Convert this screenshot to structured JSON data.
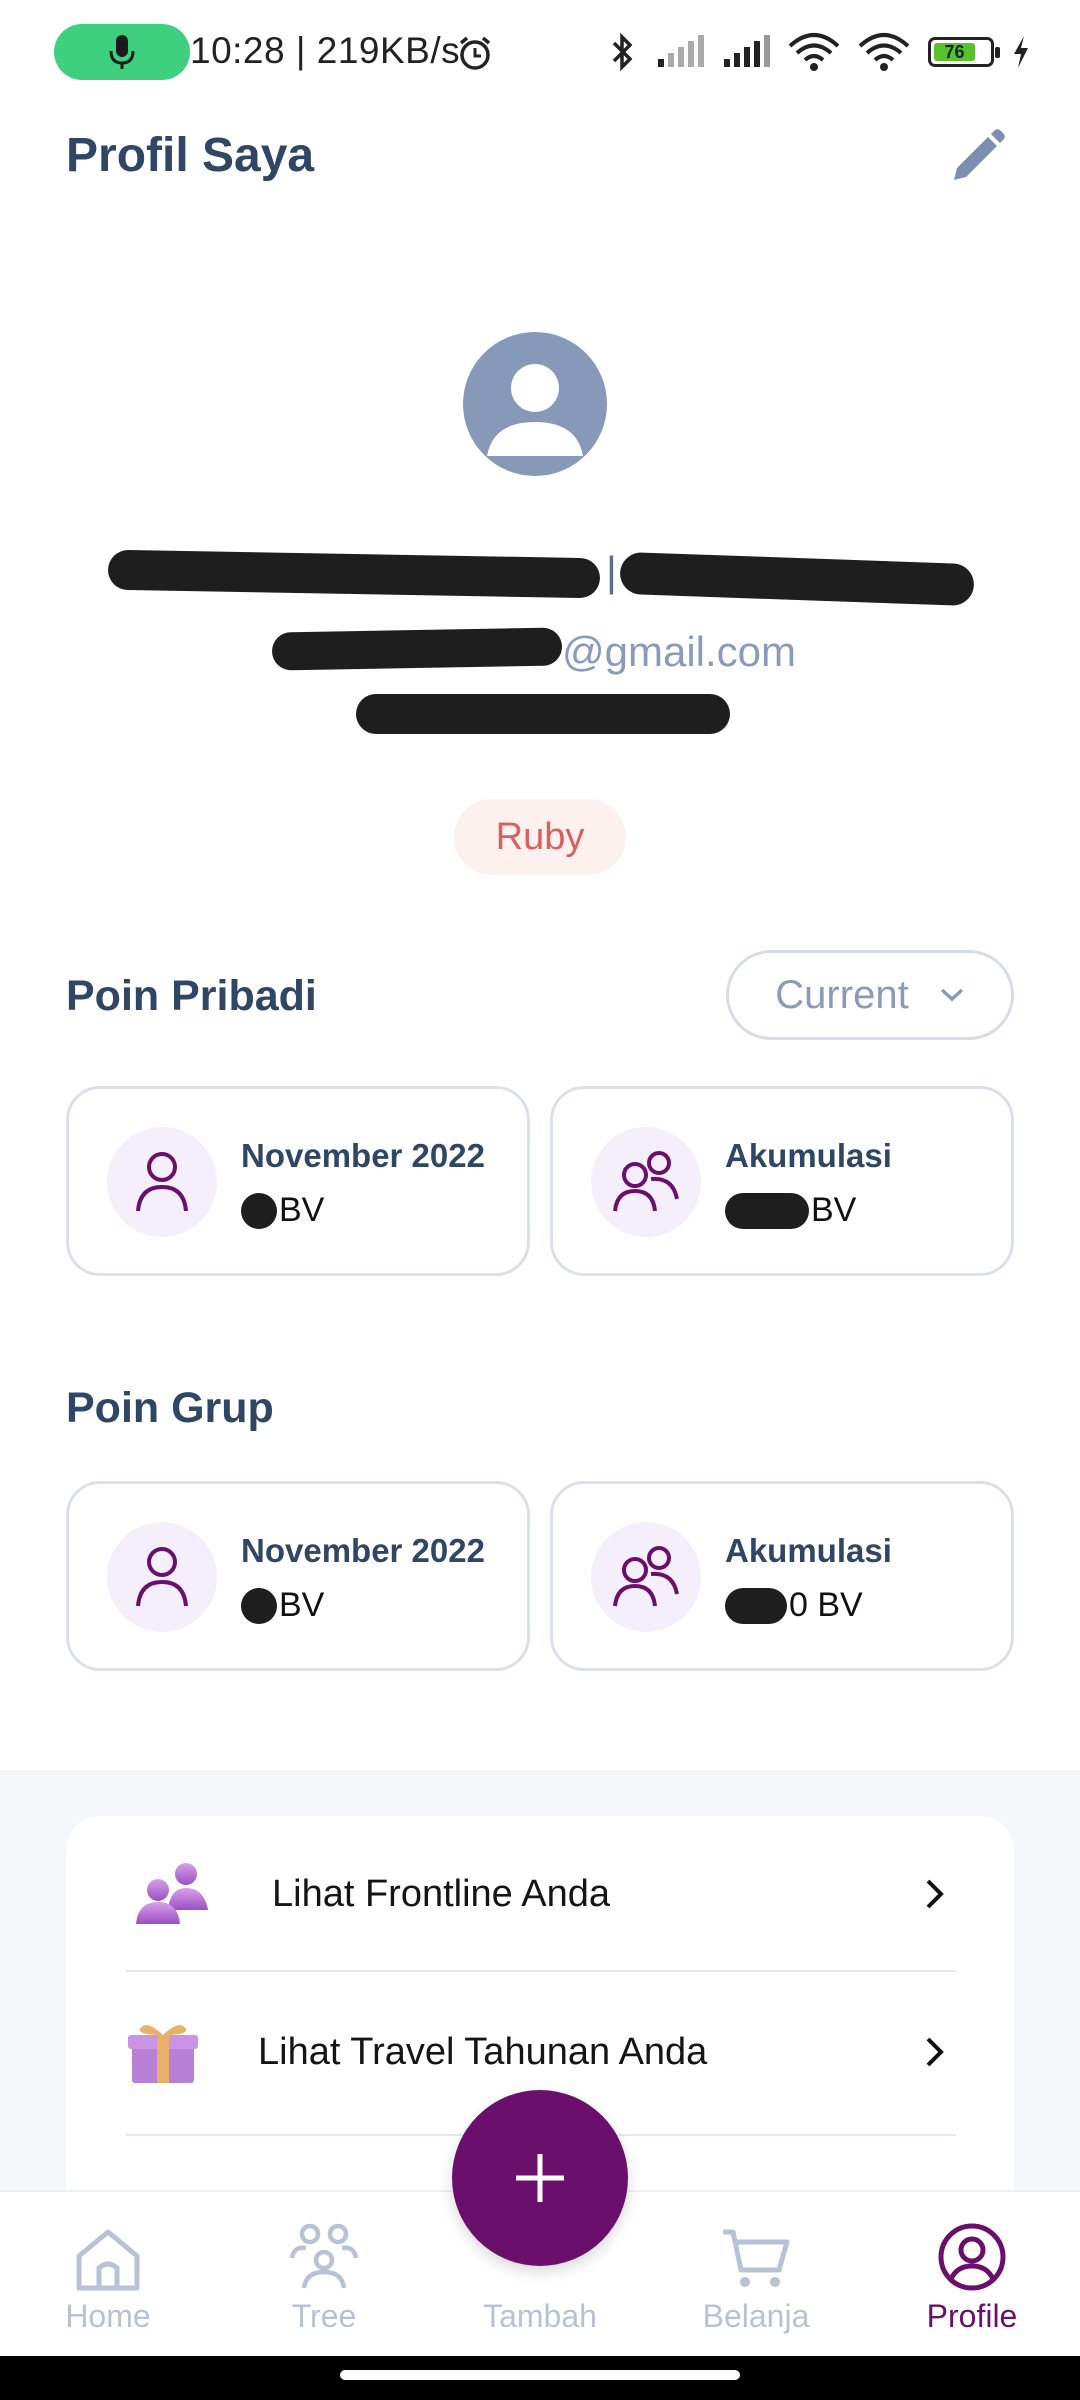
{
  "status_bar": {
    "time_speed": "10:28 | 219KB/s",
    "battery_level": "76",
    "icons": [
      "mic-icon",
      "alarm-icon",
      "bluetooth-icon",
      "signal-icon",
      "signal-icon",
      "wifi-link-icon",
      "wifi-icon",
      "battery-icon",
      "charging-icon"
    ]
  },
  "header": {
    "title": "Profil Saya",
    "edit_icon": "pencil-icon"
  },
  "profile": {
    "name_separator": "|",
    "email_visible": "@gmail.com",
    "badge": "Ruby"
  },
  "personal_points": {
    "title": "Poin Pribadi",
    "dropdown_value": "Current",
    "cards": [
      {
        "label": "November 2022",
        "unit": "BV",
        "icon": "person-icon"
      },
      {
        "label": "Akumulasi",
        "unit": "BV",
        "icon": "people-icon"
      }
    ]
  },
  "group_points": {
    "title": "Poin Grup",
    "cards": [
      {
        "label": "November 2022",
        "unit": "BV",
        "icon": "person-icon"
      },
      {
        "label": "Akumulasi",
        "unit": "0 BV",
        "icon": "people-icon"
      }
    ]
  },
  "menu": {
    "items": [
      {
        "label": "Lihat Frontline Anda",
        "icon": "frontline-people-icon"
      },
      {
        "label": "Lihat Travel Tahunan Anda",
        "icon": "gift-icon"
      }
    ]
  },
  "bottom_nav": {
    "items": [
      {
        "label": "Home",
        "icon": "home-icon"
      },
      {
        "label": "Tree",
        "icon": "tree-people-icon"
      },
      {
        "label": "Tambah",
        "icon": "plus-icon"
      },
      {
        "label": "Belanja",
        "icon": "cart-icon"
      },
      {
        "label": "Profile",
        "icon": "profile-icon"
      }
    ],
    "active": "Profile"
  },
  "colors": {
    "primary": "#6a0f6c",
    "heading": "#2f4664",
    "muted": "#8a9bba",
    "badge_text": "#d76060",
    "badge_bg": "#fdf1ef"
  }
}
